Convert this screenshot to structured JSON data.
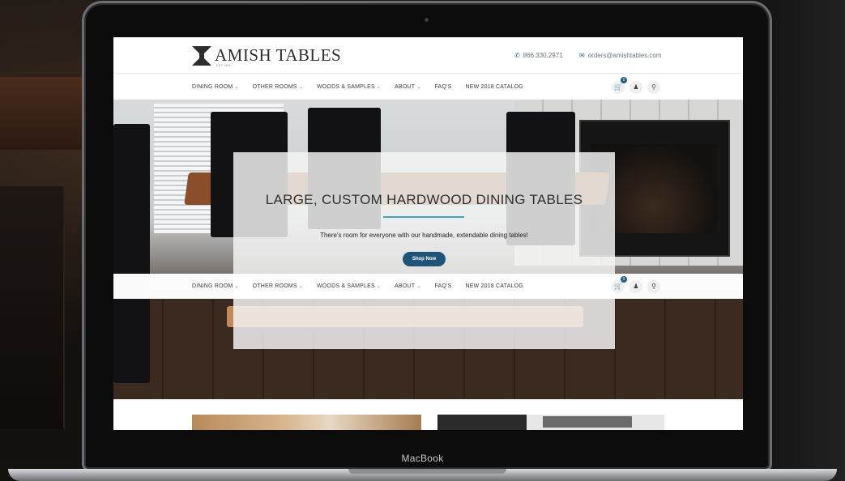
{
  "site": {
    "logo_text": "AMISH TABLES",
    "logo_sub": "EST 1996",
    "phone": "866.330.2971",
    "email": "orders@amishtables.com"
  },
  "nav": {
    "items": [
      {
        "label": "DINING ROOM",
        "has_caret": true
      },
      {
        "label": "OTHER ROOMS",
        "has_caret": true
      },
      {
        "label": "WOODS & SAMPLES",
        "has_caret": true
      },
      {
        "label": "ABOUT",
        "has_caret": true
      },
      {
        "label": "FAQ'S",
        "has_caret": false
      },
      {
        "label": "NEW 2018 CATALOG",
        "has_caret": false
      }
    ],
    "cart_count": "0",
    "icons": [
      "cart-icon",
      "user-icon",
      "search-icon"
    ]
  },
  "hero": {
    "title": "LARGE, CUSTOM HARDWOOD DINING TABLES",
    "subtitle": "There's room for everyone with our handmade, extendable dining tables!",
    "button_label": "Shop Now"
  },
  "device": {
    "label": "MacBook"
  },
  "colors": {
    "accent": "#1f5476",
    "rule": "#3fa3c5"
  }
}
